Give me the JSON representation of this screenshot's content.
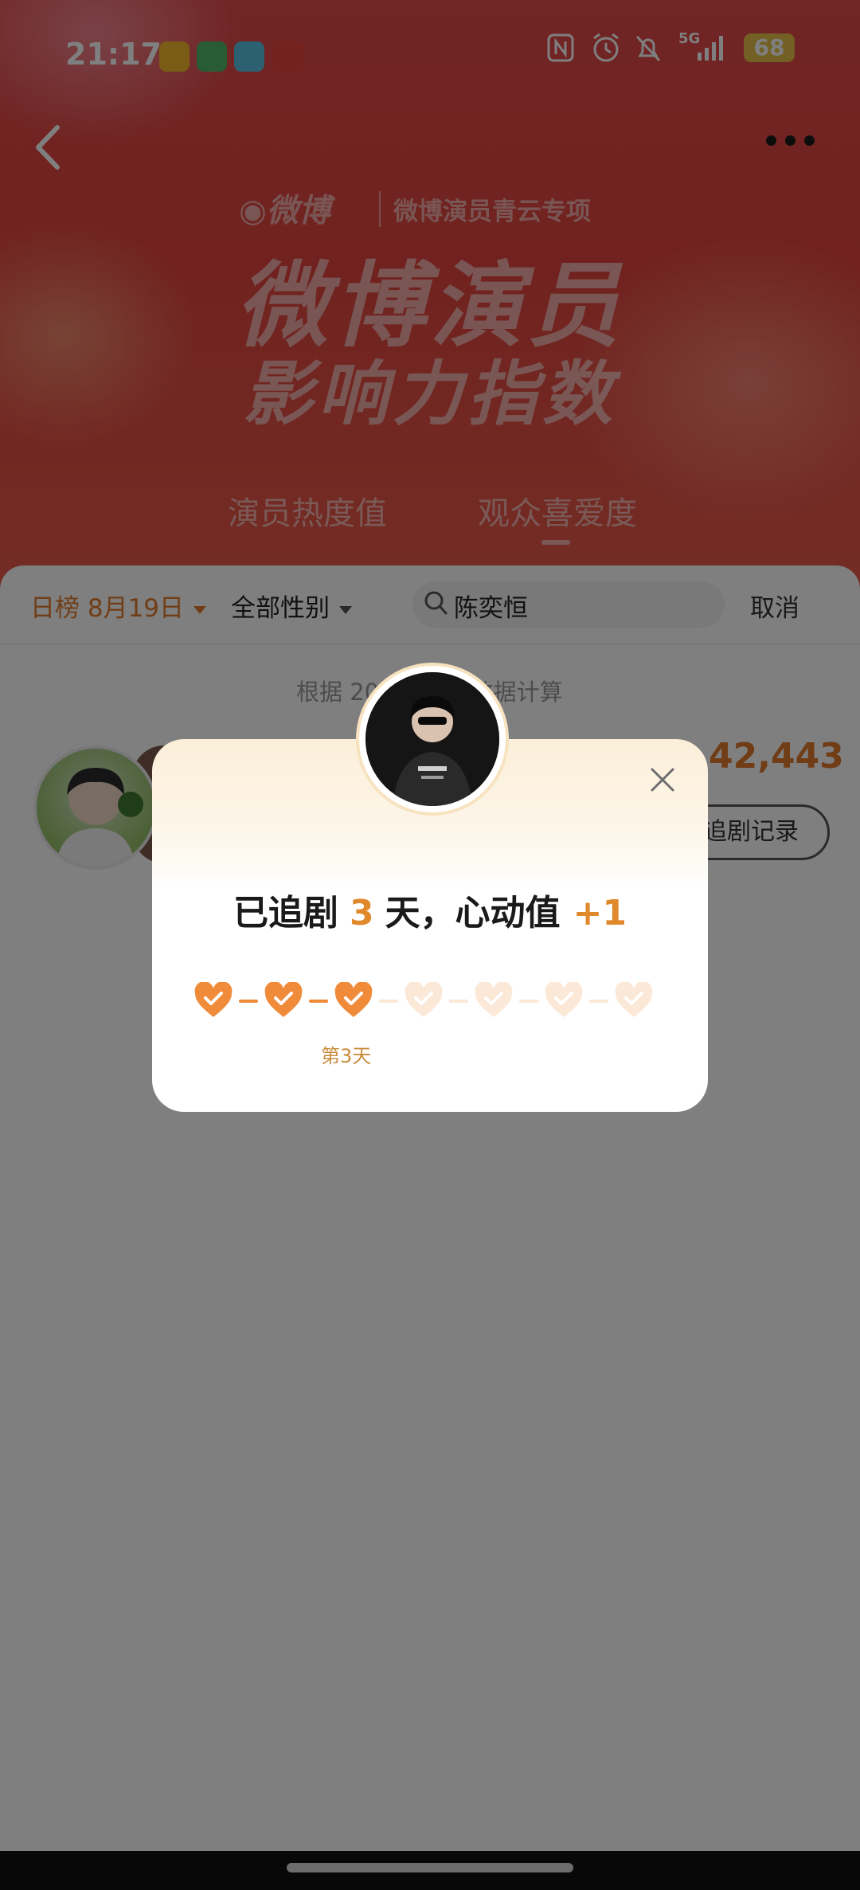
{
  "status_bar": {
    "time": "21:17",
    "battery": "68",
    "network": "5G"
  },
  "header": {
    "brand_logo": "微博",
    "brand_subtitle": "微博演员青云专项",
    "title_line1": "微博演员",
    "title_line2": "影响力指数",
    "tabs": [
      {
        "label": "演员热度值",
        "active": false
      },
      {
        "label": "观众喜爱度",
        "active": true
      }
    ]
  },
  "filters": {
    "date_filter": "日榜 8月19日",
    "gender_filter": "全部性别",
    "search_value": "陈奕恒",
    "cancel_label": "取消"
  },
  "list": {
    "note_prefix": "根据 202",
    "note_suffix": "数据计算",
    "score": "42,443",
    "record_button": "追剧记录"
  },
  "modal": {
    "headline_prefix": "已追剧",
    "days": "3",
    "headline_mid": "天，心动值",
    "heart_bonus": "+1",
    "day_label": "第3天",
    "hearts_total": 7,
    "hearts_filled": 3,
    "colors": {
      "filled": "#f08b3a",
      "empty": "#fbe8d6",
      "accent": "#e0882c"
    }
  }
}
